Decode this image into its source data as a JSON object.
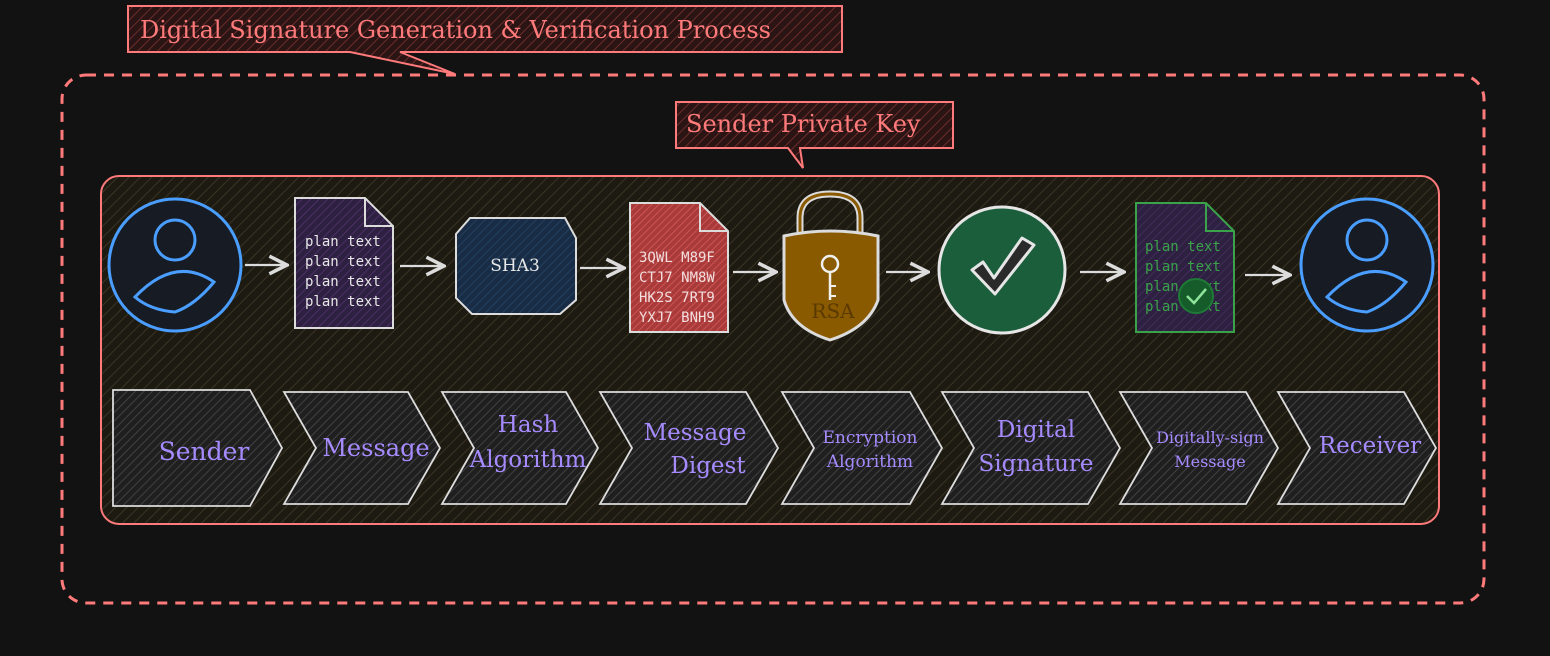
{
  "title": "Digital Signature Generation & Verification Process",
  "key_label": "Sender Private Key",
  "icons": {
    "sender": "user-icon",
    "message": "document-icon",
    "hash": "hash-box-icon",
    "digest": "document-icon",
    "encryption": "padlock-icon",
    "signature": "check-circle-icon",
    "signed_message": "signed-document-icon",
    "receiver": "user-icon"
  },
  "message_lines": [
    "plan text",
    "plan text",
    "plan text",
    "plan text"
  ],
  "hash_label": "SHA3",
  "digest_lines": [
    "3QWL M89F",
    "CTJ7 NM8W",
    "HK2S 7RT9",
    "YXJ7 BNH9"
  ],
  "lock_label": "RSA",
  "signed_lines": [
    "plan text",
    "plan text",
    "plan text",
    "plan text"
  ],
  "steps": [
    {
      "lines": [
        "Sender"
      ]
    },
    {
      "lines": [
        "Message"
      ]
    },
    {
      "lines": [
        "Hash",
        "Algorithm"
      ]
    },
    {
      "lines": [
        "Message",
        "Digest"
      ]
    },
    {
      "lines": [
        "Encryption",
        "Algorithm"
      ]
    },
    {
      "lines": [
        "Digital",
        "Signature"
      ]
    },
    {
      "lines": [
        "Digitally-sign",
        "Message"
      ]
    },
    {
      "lines": [
        "Receiver"
      ]
    }
  ],
  "colors": {
    "accent": "#ff7a7a",
    "user": "#4a9eff",
    "step_text": "#a68bff",
    "message_doc": "#3d2a55",
    "hash_box": "#1e3a5f",
    "digest_doc": "#c64545",
    "lock": "#8a5a00",
    "signature": "#1b5e3b",
    "signed_doc": "#2f7a3a"
  }
}
